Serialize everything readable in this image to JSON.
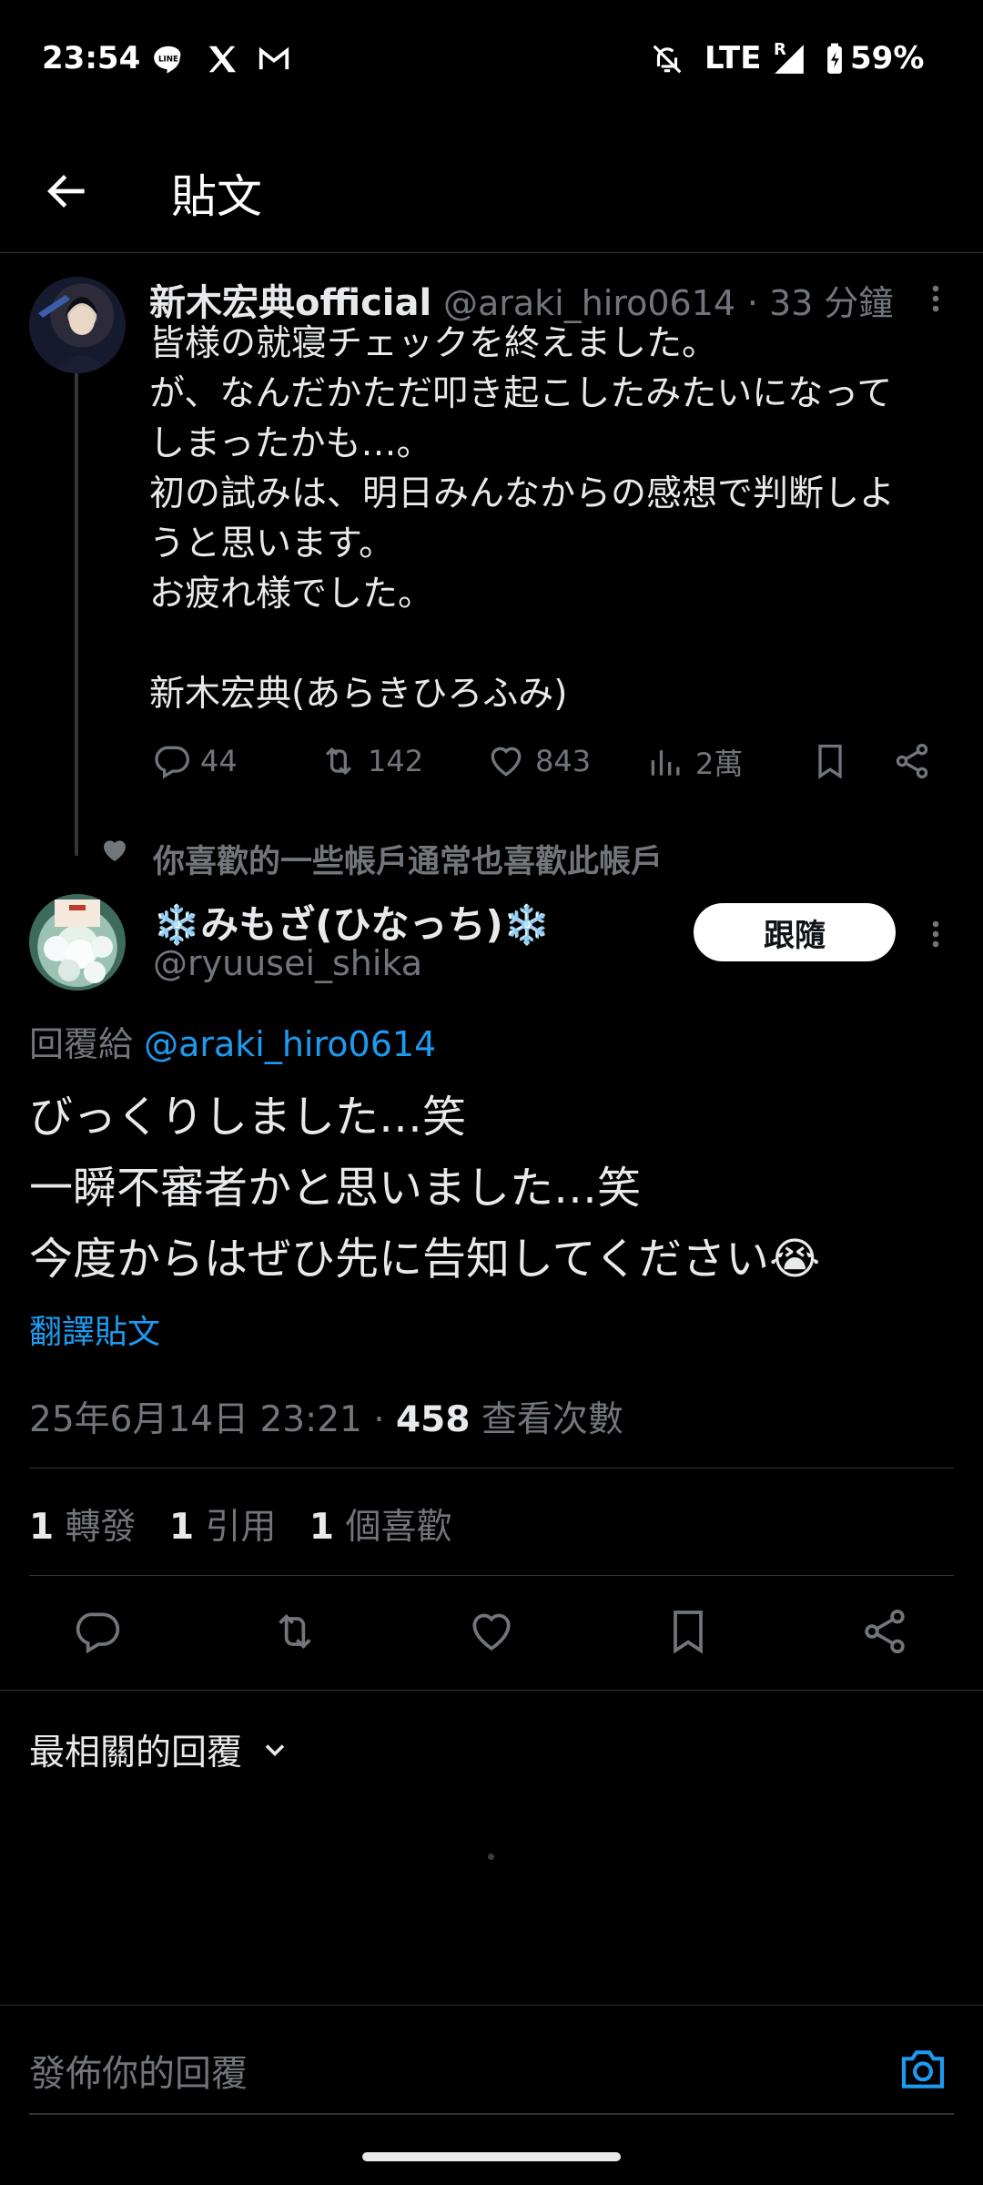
{
  "status_bar": {
    "time": "23:54",
    "network": "LTE",
    "roaming": "R",
    "battery": "59%",
    "icons": [
      "line-icon",
      "x-icon",
      "gmail-icon",
      "mute-icon",
      "signal-icon",
      "battery-icon"
    ]
  },
  "header": {
    "title": "貼文",
    "back_icon": "arrow-left-icon"
  },
  "parent_tweet": {
    "name": "新木宏典official",
    "handle": "@araki_hiro0614",
    "time": "· 33 分鐘",
    "lines": [
      "皆様の就寝チェックを終えました。",
      "が、なんだかただ叩き起こしたみたいになって",
      "しまったかも…。",
      "初の試みは、明日みんなからの感想で判断しよ",
      "うと思います。",
      "お疲れ様でした。",
      "",
      "新木宏典(あらきひろふみ)"
    ],
    "replies": "44",
    "retweets": "142",
    "likes": "843",
    "views": "2萬"
  },
  "social_context": "你喜歡的一些帳戶通常也喜歡此帳戶",
  "reply_tweet": {
    "name": "❄️みもざ(ひなっち)❄️",
    "handle": "@ryuusei_shika",
    "follow_label": "跟隨",
    "replying_to_prefix": "回覆給 ",
    "replying_to_handle": "@araki_hiro0614",
    "lines": [
      "びっくりしました…笑",
      "一瞬不審者かと思いました…笑",
      "今度からはぜひ先に告知してください😭"
    ],
    "translate": "翻譯貼文",
    "timestamp": "25年6月14日 23:21 · ",
    "view_count": "458",
    "view_label": " 查看次數",
    "stats": [
      {
        "count": "1",
        "label": " 轉發"
      },
      {
        "count": "1",
        "label": " 引用"
      },
      {
        "count": "1",
        "label": " 個喜歡"
      }
    ]
  },
  "sort_label": "最相關的回覆",
  "reply_placeholder": "發佈你的回覆",
  "colors": {
    "background": "#000000",
    "accent": "#1d9bf0",
    "muted": "#71767b"
  }
}
